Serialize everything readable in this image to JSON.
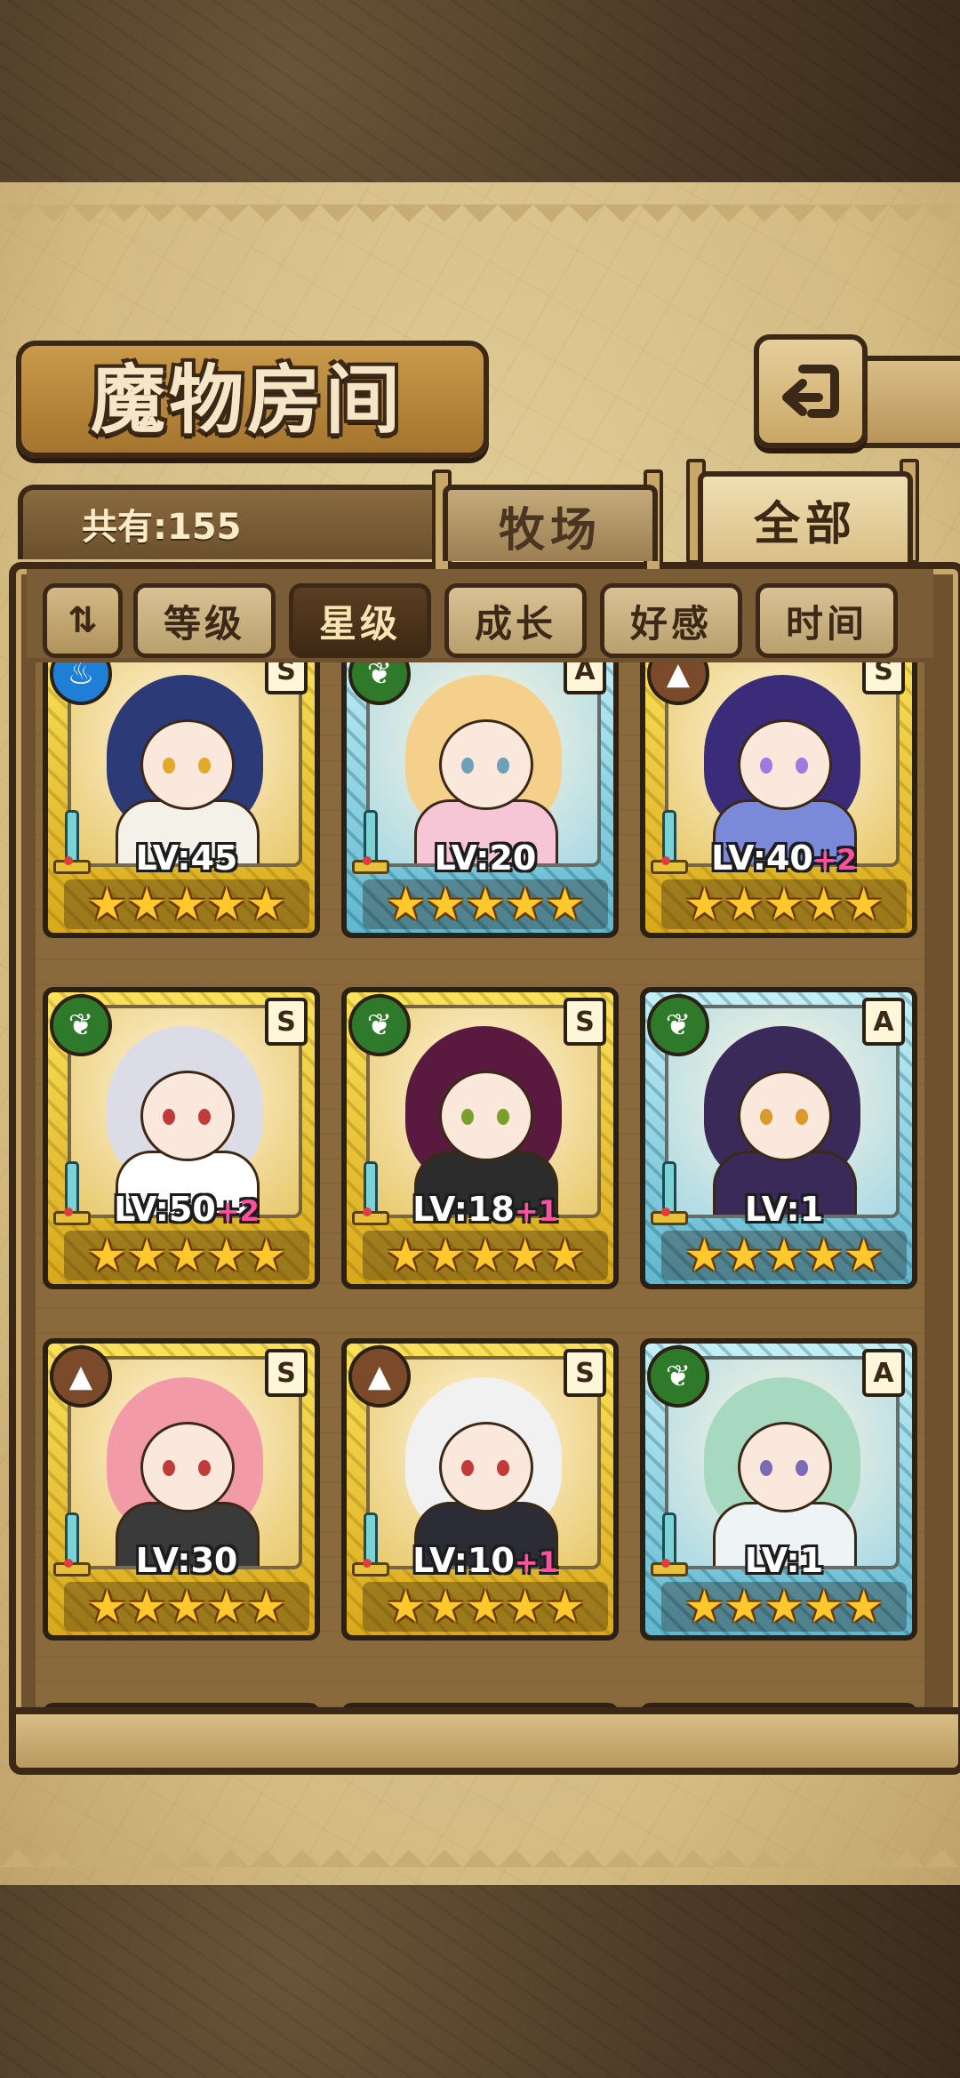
{
  "title": "魔物房间",
  "count_text": "共有:155",
  "tabs": {
    "ranch": "牧场",
    "all": "全部"
  },
  "sort": {
    "toggle": "⇅",
    "buttons": [
      "等级",
      "星级",
      "成长",
      "好感",
      "时间"
    ],
    "active": "星级"
  },
  "cards": [
    {
      "frame": "gold",
      "element": "water",
      "rank": "S",
      "level": "LV:45",
      "plus": "",
      "stars": "★★★★★",
      "hair": "#2c3a78",
      "eye": "#e2a92b",
      "outfit": "#f4f1e8"
    },
    {
      "frame": "blue",
      "element": "grass",
      "rank": "A",
      "level": "LV:20",
      "plus": "",
      "stars": "★★★★★",
      "hair": "#f4d08a",
      "eye": "#6fa0b8",
      "outfit": "#f6c6d6"
    },
    {
      "frame": "gold",
      "element": "earth",
      "rank": "S",
      "level": "LV:40",
      "plus": "+2",
      "stars": "★★★★★",
      "hair": "#3b2c7a",
      "eye": "#a277e0",
      "outfit": "#7a8ad8"
    },
    {
      "frame": "gold",
      "element": "grass",
      "rank": "S",
      "level": "LV:50",
      "plus": "+2",
      "stars": "★★★★★",
      "hair": "#dcdce6",
      "eye": "#c23b3b",
      "outfit": "#ffffff"
    },
    {
      "frame": "gold",
      "element": "grass",
      "rank": "S",
      "level": "LV:18",
      "plus": "+1",
      "stars": "★★★★★",
      "hair": "#5a1a3f",
      "eye": "#7aa02b",
      "outfit": "#2c2c2c"
    },
    {
      "frame": "blue",
      "element": "grass",
      "rank": "A",
      "level": "LV:1",
      "plus": "",
      "stars": "★★★★★",
      "hair": "#3a2a5a",
      "eye": "#d99a2b",
      "outfit": "#3a2a5a"
    },
    {
      "frame": "gold",
      "element": "earth",
      "rank": "S",
      "level": "LV:30",
      "plus": "",
      "stars": "★★★★★",
      "hair": "#f29aa8",
      "eye": "#c23b3b",
      "outfit": "#3a3a3a"
    },
    {
      "frame": "gold",
      "element": "earth",
      "rank": "S",
      "level": "LV:10",
      "plus": "+1",
      "stars": "★★★★★",
      "hair": "#f1f1f1",
      "eye": "#c23b3b",
      "outfit": "#2c2c36"
    },
    {
      "frame": "blue",
      "element": "grass",
      "rank": "A",
      "level": "LV:1",
      "plus": "",
      "stars": "★★★★★",
      "hair": "#a7d9c0",
      "eye": "#7a6ab8",
      "outfit": "#eef3f5"
    }
  ],
  "element_styles": {
    "water": {
      "color": "#1f7ed6",
      "glyph": "♨"
    },
    "grass": {
      "color": "#2f7a2a",
      "glyph": "❦"
    },
    "earth": {
      "color": "#7a4a2a",
      "glyph": "▲"
    }
  },
  "colors": {
    "gold_frame": "#f2cf2e",
    "blue_frame": "#8fd4e4",
    "plus": "#ff4fa0",
    "star": "#ffc92e"
  }
}
